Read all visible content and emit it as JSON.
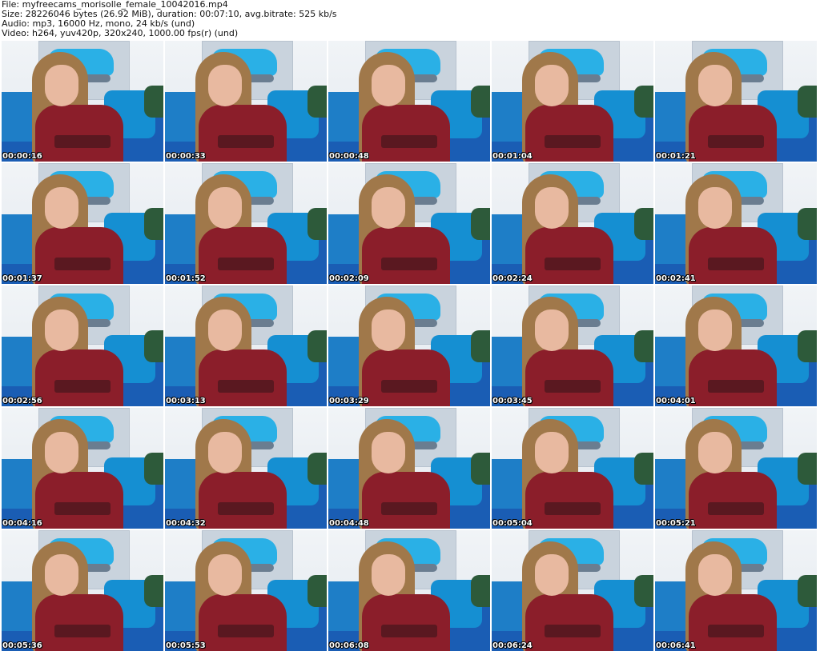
{
  "header": {
    "file_line": "File: myfreecams_morisolle_female_10042016.mp4",
    "size_line": "Size: 28226046 bytes (26.92 MiB), duration: 00:07:10, avg.bitrate: 525 kb/s",
    "audio_line": "Audio: mp3, 16000 Hz, mono, 24 kb/s (und)",
    "video_line": "Video: h264, yuv420p, 320x240, 1000.00 fps(r) (und)"
  },
  "thumbnails": [
    {
      "timestamp": "00:00:16"
    },
    {
      "timestamp": "00:00:33"
    },
    {
      "timestamp": "00:00:48"
    },
    {
      "timestamp": "00:01:04"
    },
    {
      "timestamp": "00:01:21"
    },
    {
      "timestamp": "00:01:37"
    },
    {
      "timestamp": "00:01:52"
    },
    {
      "timestamp": "00:02:09"
    },
    {
      "timestamp": "00:02:24"
    },
    {
      "timestamp": "00:02:41"
    },
    {
      "timestamp": "00:02:56"
    },
    {
      "timestamp": "00:03:13"
    },
    {
      "timestamp": "00:03:29"
    },
    {
      "timestamp": "00:03:45"
    },
    {
      "timestamp": "00:04:01"
    },
    {
      "timestamp": "00:04:16"
    },
    {
      "timestamp": "00:04:32"
    },
    {
      "timestamp": "00:04:48"
    },
    {
      "timestamp": "00:05:04"
    },
    {
      "timestamp": "00:05:21"
    },
    {
      "timestamp": "00:05:36"
    },
    {
      "timestamp": "00:05:53"
    },
    {
      "timestamp": "00:06:08"
    },
    {
      "timestamp": "00:06:24"
    },
    {
      "timestamp": "00:06:41"
    }
  ]
}
